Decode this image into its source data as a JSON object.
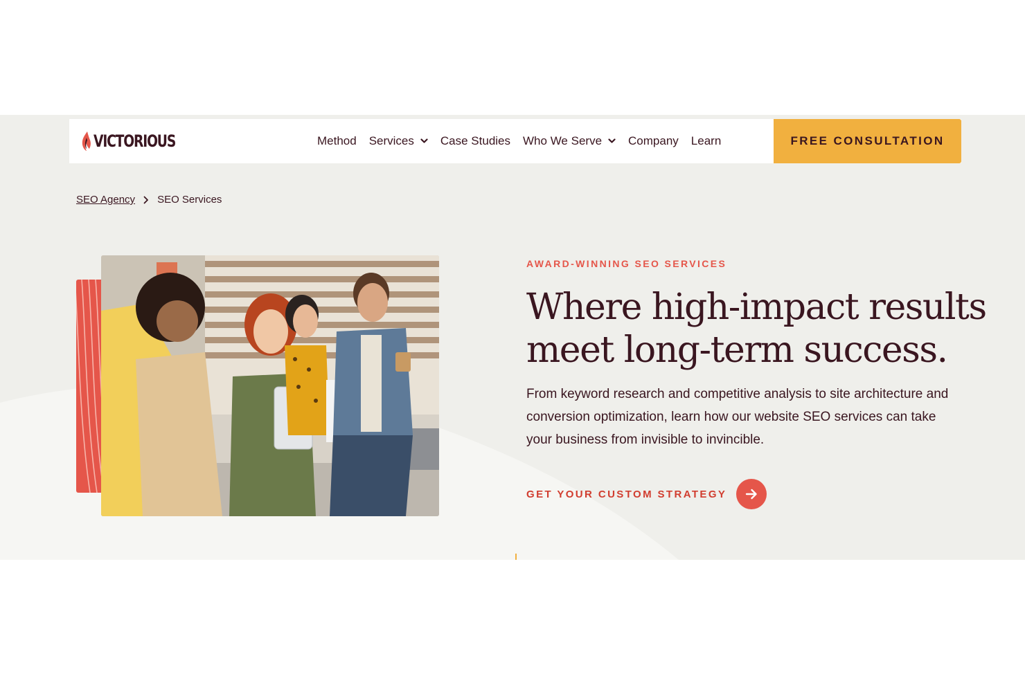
{
  "brand": {
    "logo_text": "VICTORIOUS",
    "logo_icon": "flame-icon",
    "accent_color": "#e5564a",
    "cta_color": "#f1b03f",
    "text_color": "#3a1620",
    "background_color": "#efefeb"
  },
  "nav": {
    "items": [
      {
        "label": "Method",
        "has_dropdown": false
      },
      {
        "label": "Services",
        "has_dropdown": true
      },
      {
        "label": "Case Studies",
        "has_dropdown": false
      },
      {
        "label": "Who We Serve",
        "has_dropdown": true
      },
      {
        "label": "Company",
        "has_dropdown": false
      },
      {
        "label": "Learn",
        "has_dropdown": false
      }
    ],
    "cta_label": "FREE CONSULTATION",
    "dropdown_icon": "chevron-down-icon"
  },
  "breadcrumb": {
    "parent": "SEO Agency",
    "current": "SEO Services",
    "separator_icon": "chevron-right-icon"
  },
  "hero": {
    "eyebrow": "AWARD-WINNING SEO SERVICES",
    "headline_line1": "Where high-impact results",
    "headline_line2": "meet long-term success.",
    "body": "From keyword research and competitive analysis to site architecture and conversion optimization, learn how our website SEO services can take your business from invisible to invincible.",
    "link_label": "GET YOUR CUSTOM STRATEGY",
    "link_icon": "arrow-right-icon"
  }
}
